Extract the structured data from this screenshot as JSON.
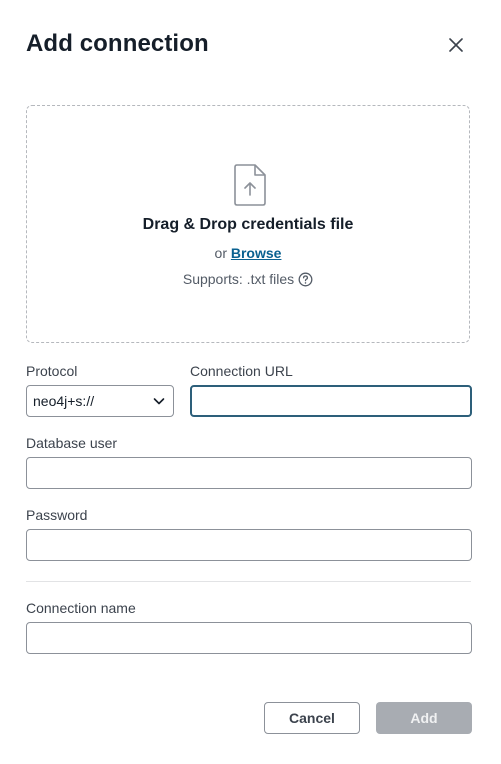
{
  "dialog": {
    "title": "Add connection",
    "close_icon": "close-icon"
  },
  "dropzone": {
    "icon": "file-upload-icon",
    "title": "Drag & Drop credentials file",
    "or_text": "or",
    "browse_label": "Browse",
    "supports_text": "Supports: .txt files",
    "help_icon": "help-circle-icon"
  },
  "form": {
    "protocol": {
      "label": "Protocol",
      "value": "neo4j+s://"
    },
    "connection_url": {
      "label": "Connection URL",
      "value": ""
    },
    "database_user": {
      "label": "Database user",
      "value": ""
    },
    "password": {
      "label": "Password",
      "value": ""
    },
    "connection_name": {
      "label": "Connection name",
      "value": ""
    }
  },
  "actions": {
    "cancel_label": "Cancel",
    "add_label": "Add"
  },
  "colors": {
    "link": "#0a6190",
    "focus_border": "#2d5f7a",
    "disabled_button": "#a8acb2"
  }
}
